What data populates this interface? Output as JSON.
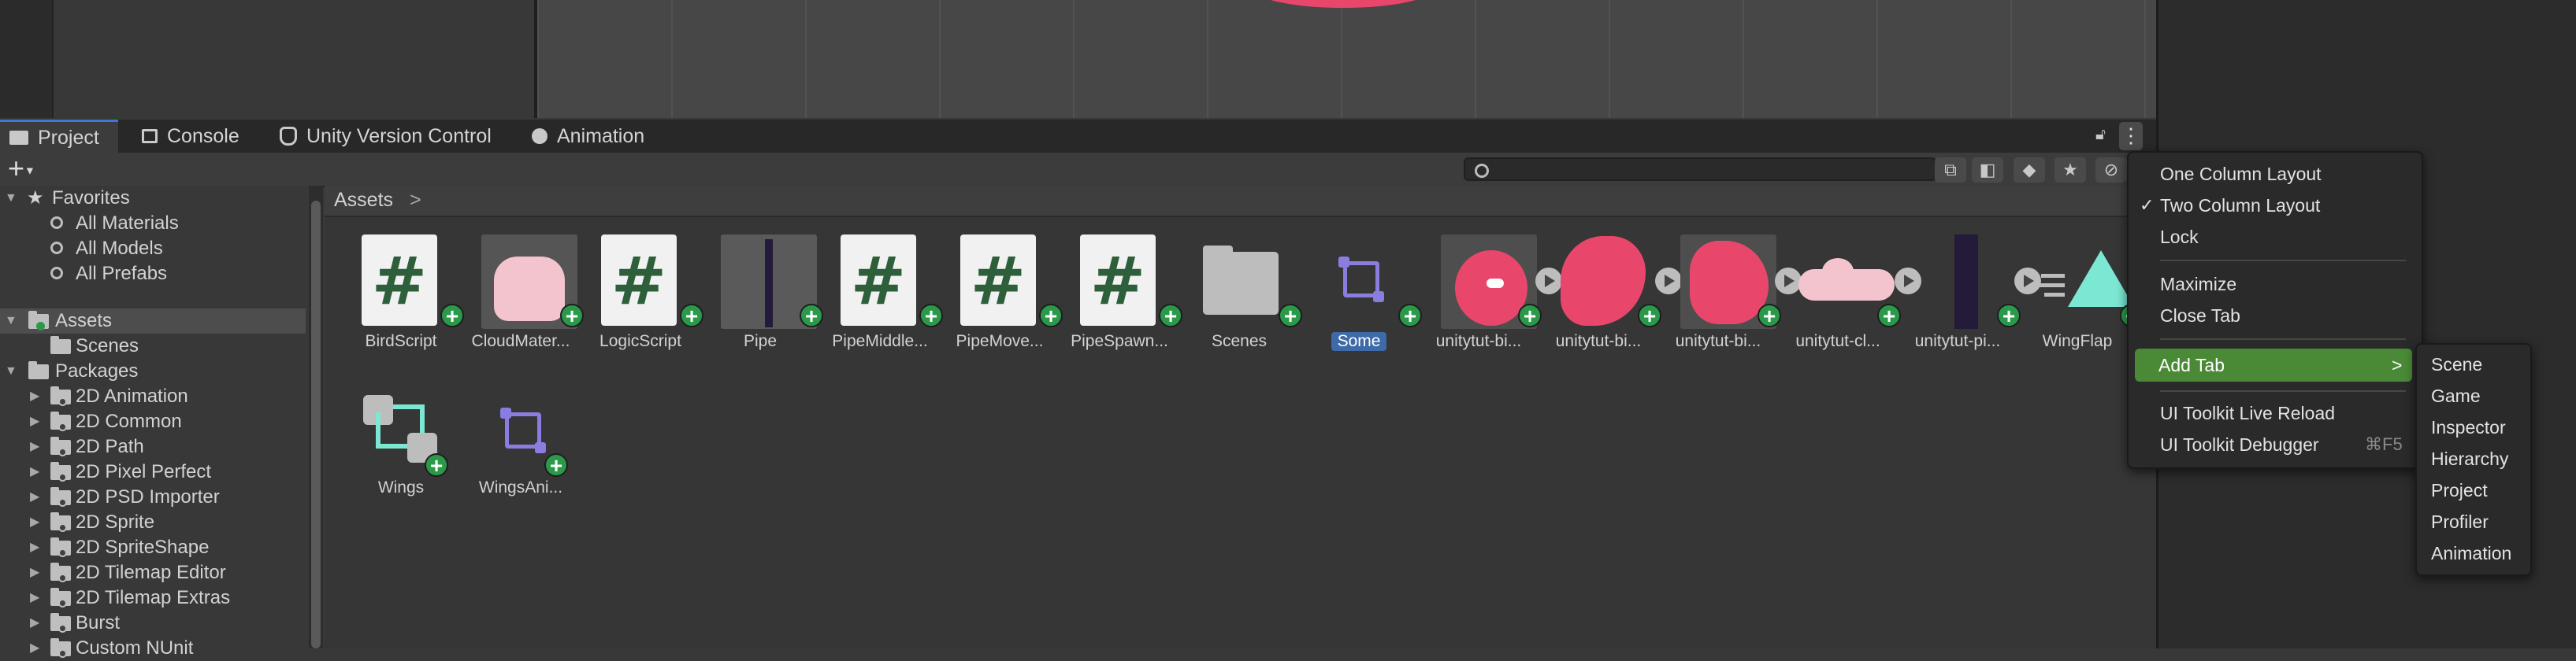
{
  "tabs": [
    {
      "label": "Project",
      "icon": "folder-icon"
    },
    {
      "label": "Console",
      "icon": "console-icon"
    },
    {
      "label": "Unity Version Control",
      "icon": "version-control-icon"
    },
    {
      "label": "Animation",
      "icon": "clock-icon"
    }
  ],
  "toolbar": {
    "create_label": "+",
    "search_placeholder": ""
  },
  "tree": {
    "favorites_label": "Favorites",
    "favorites": [
      "All Materials",
      "All Models",
      "All Prefabs"
    ],
    "assets_label": "Assets",
    "assets_children": [
      "Scenes"
    ],
    "packages_label": "Packages",
    "packages": [
      "2D Animation",
      "2D Common",
      "2D Path",
      "2D Pixel Perfect",
      "2D PSD Importer",
      "2D Sprite",
      "2D SpriteShape",
      "2D Tilemap Editor",
      "2D Tilemap Extras",
      "Burst",
      "Custom NUnit"
    ]
  },
  "breadcrumb": {
    "label": "Assets",
    "chevron": ">"
  },
  "assets": [
    {
      "name": "BirdScript",
      "kind": "script"
    },
    {
      "name": "CloudMater...",
      "kind": "material"
    },
    {
      "name": "LogicScript",
      "kind": "script"
    },
    {
      "name": "Pipe",
      "kind": "prefab"
    },
    {
      "name": "PipeMiddle...",
      "kind": "script"
    },
    {
      "name": "PipeMove...",
      "kind": "script"
    },
    {
      "name": "PipeSpawn...",
      "kind": "script"
    },
    {
      "name": "Scenes",
      "kind": "folder"
    },
    {
      "name": "Some",
      "kind": "animator",
      "selected": true
    },
    {
      "name": "unitytut-bi...",
      "kind": "sprite-bird"
    },
    {
      "name": "unitytut-bi...",
      "kind": "sprite-wing"
    },
    {
      "name": "unitytut-bi...",
      "kind": "sprite-wing2"
    },
    {
      "name": "unitytut-cl...",
      "kind": "sprite-cloud"
    },
    {
      "name": "unitytut-pi...",
      "kind": "sprite-pipe"
    },
    {
      "name": "WingFlap",
      "kind": "animation"
    },
    {
      "name": "Wings",
      "kind": "blendtree"
    },
    {
      "name": "WingsAni...",
      "kind": "animator"
    }
  ],
  "menu": {
    "items": [
      "One Column Layout",
      "Two Column Layout",
      "Lock",
      "Maximize",
      "Close Tab",
      "Add Tab",
      "UI Toolkit Live Reload",
      "UI Toolkit Debugger"
    ],
    "checked_item": "Two Column Layout",
    "check_mark": "✓",
    "submenu_arrow": ">",
    "debugger_shortcut": "⌘F5"
  },
  "submenu": {
    "items": [
      "Scene",
      "Game",
      "Inspector",
      "Hierarchy",
      "Project",
      "Profiler",
      "Animation"
    ]
  },
  "colors": {
    "accent_blue": "#3a79d7",
    "highlight_green": "#4a8a36",
    "plus_green": "#2a9a4a",
    "bird_pink": "#e8476b"
  }
}
